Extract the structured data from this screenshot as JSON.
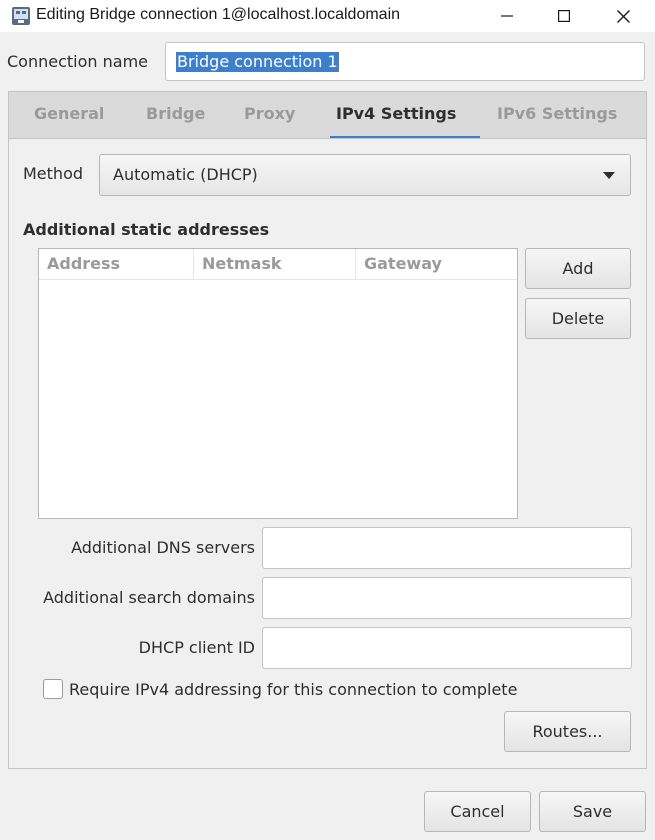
{
  "window": {
    "title": "Editing Bridge connection 1@localhost.localdomain",
    "icons": {
      "app": "network-editor-icon",
      "minimize": "minimize-icon",
      "maximize": "maximize-icon",
      "close": "close-icon"
    }
  },
  "connection": {
    "label": "Connection name",
    "value": "Bridge connection 1"
  },
  "tabs": [
    {
      "label": "General",
      "active": false
    },
    {
      "label": "Bridge",
      "active": false
    },
    {
      "label": "Proxy",
      "active": false
    },
    {
      "label": "IPv4 Settings",
      "active": true
    },
    {
      "label": "IPv6 Settings",
      "active": false
    }
  ],
  "ipv4": {
    "method_label": "Method",
    "method_value": "Automatic (DHCP)",
    "section_title": "Additional static addresses",
    "table_columns": [
      "Address",
      "Netmask",
      "Gateway"
    ],
    "table_rows": [],
    "add_button": "Add",
    "delete_button": "Delete",
    "dns_label": "Additional DNS servers",
    "dns_value": "",
    "search_label": "Additional search domains",
    "search_value": "",
    "dhcp_label": "DHCP client ID",
    "dhcp_value": "",
    "require_label": "Require IPv4 addressing for this connection to complete",
    "require_checked": false,
    "routes_button": "Routes..."
  },
  "footer": {
    "cancel": "Cancel",
    "save": "Save"
  },
  "colors": {
    "accent": "#3d7fcb"
  }
}
